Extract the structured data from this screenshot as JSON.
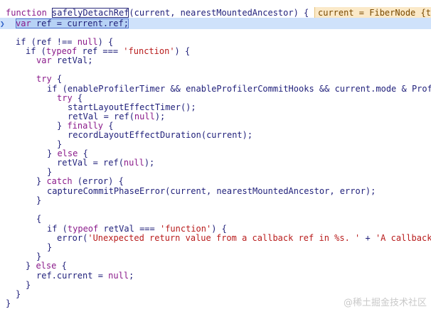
{
  "hint": {
    "text": "current = FiberNode {t"
  },
  "watermark": {
    "text": "@稀土掘金技术社区"
  },
  "code": {
    "l1": {
      "kw": "function",
      "name": "safelyDetachRef",
      "params": "(current, nearestMountedAncestor) {"
    },
    "l2": {
      "text": "var ref = current.ref;"
    },
    "l4": {
      "a": "if (ref !== ",
      "null": "null",
      "b": ") {"
    },
    "l5": {
      "a": "if (",
      "typeof": "typeof",
      "b": " ref === ",
      "str": "'function'",
      "c": ") {"
    },
    "l6": {
      "kw": "var",
      "b": " retVal;"
    },
    "l8": {
      "kw": "try",
      "b": " {"
    },
    "l9": {
      "a": "if (enableProfilerTimer && enableProfilerCommitHooks && current.mode & Prof"
    },
    "l10": {
      "kw": "try",
      "b": " {"
    },
    "l11": {
      "a": "startLayoutEffectTimer();"
    },
    "l12": {
      "a": "retVal = ref(",
      "null": "null",
      "b": ");"
    },
    "l13": {
      "a": "} ",
      "kw": "finally",
      "b": " {"
    },
    "l14": {
      "a": "recordLayoutEffectDuration(current);"
    },
    "l15": {
      "a": "}"
    },
    "l16": {
      "a": "} ",
      "kw": "else",
      "b": " {"
    },
    "l17": {
      "a": "retVal = ref(",
      "null": "null",
      "b": ");"
    },
    "l18": {
      "a": "}"
    },
    "l19": {
      "a": "} ",
      "kw": "catch",
      "b": " (error) {"
    },
    "l20": {
      "a": "captureCommitPhaseError(current, nearestMountedAncestor, error);"
    },
    "l21": {
      "a": "}"
    },
    "l23": {
      "a": "{"
    },
    "l24": {
      "a": "if (",
      "typeof": "typeof",
      "b": " retVal === ",
      "str": "'function'",
      "c": ") {"
    },
    "l25": {
      "a": "error(",
      "str": "'Unexpected return value from a callback ref in %s. '",
      "b": " + ",
      "str2": "'A callback"
    },
    "l26": {
      "a": "}"
    },
    "l27": {
      "a": "}"
    },
    "l28": {
      "a": "} ",
      "kw": "else",
      "b": " {"
    },
    "l29": {
      "a": "ref.current = ",
      "null": "null",
      "b": ";"
    },
    "l30": {
      "a": "}"
    },
    "l31": {
      "a": "}"
    },
    "l32": {
      "a": "}"
    }
  }
}
